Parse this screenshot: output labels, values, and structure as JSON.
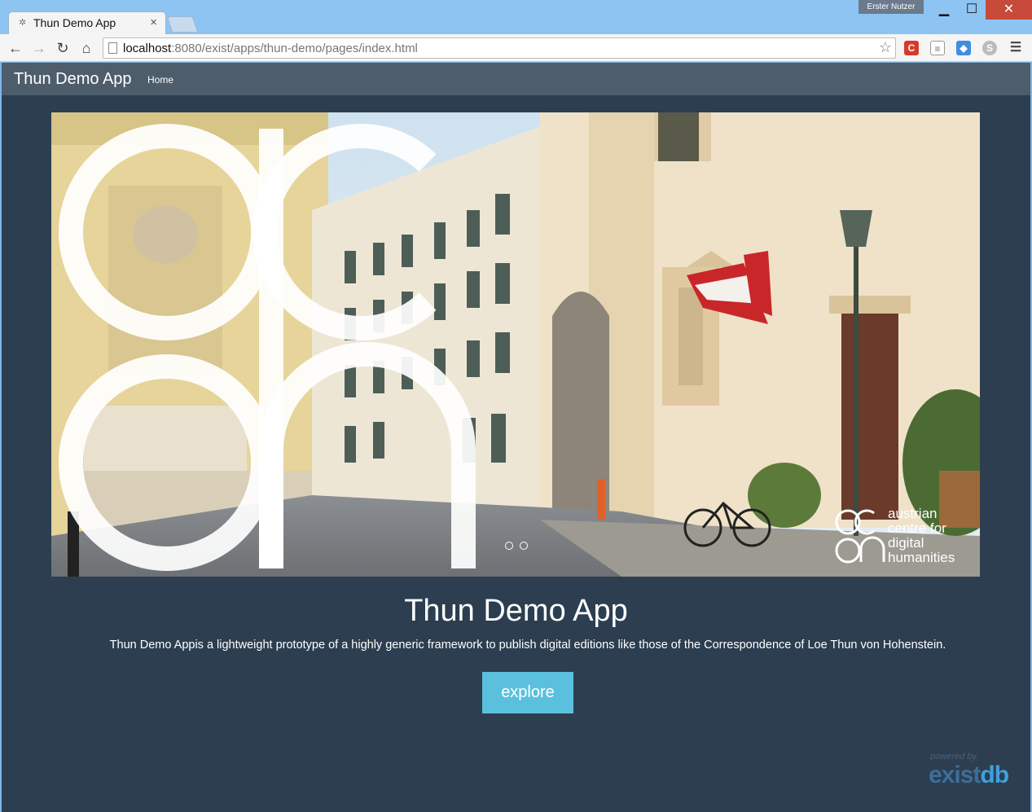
{
  "browser": {
    "tab_title": "Thun Demo App",
    "user_badge": "Erster Nutzer",
    "url_host": "localhost",
    "url_rest": ":8080/exist/apps/thun-demo/pages/index.html",
    "icons": {
      "back": "back-arrow-icon",
      "forward": "forward-arrow-icon",
      "reload": "reload-icon",
      "home": "home-icon",
      "star": "bookmark-star-icon",
      "menu": "hamburger-menu-icon"
    }
  },
  "app": {
    "brand": "Thun Demo App",
    "nav_home": "Home",
    "carousel": {
      "indicators": 2,
      "active_indicator": 0,
      "logo_text": [
        "austrian",
        "centre for",
        "digital",
        "humanities"
      ]
    },
    "hero": {
      "title": "Thun Demo App",
      "description": "Thun Demo Appis a lightweight prototype of a highly generic framework to publish digital editions like those of the Correspondence of Loe Thun von Hohenstein.",
      "button": "explore"
    },
    "footer": {
      "powered_by": "powered by",
      "logo_ex": "exist",
      "logo_db": "db"
    }
  },
  "colors": {
    "navbar": "#4e5d6c",
    "background": "#2c3e50",
    "button": "#5bc0de"
  }
}
